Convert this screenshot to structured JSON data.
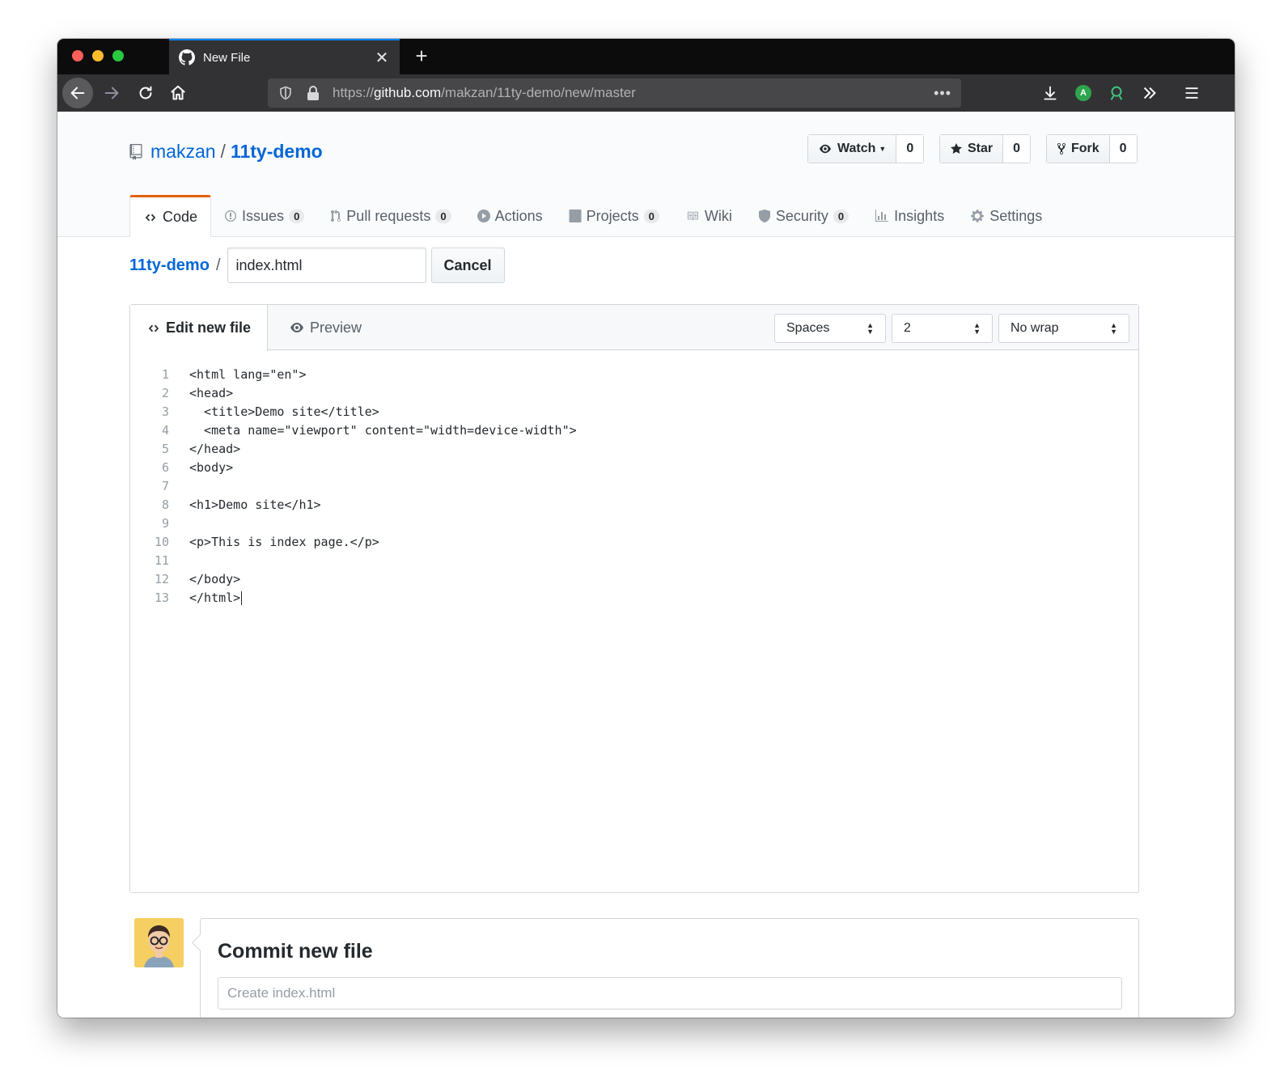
{
  "browser": {
    "tab_title": "New File",
    "url_scheme": "https://",
    "url_host": "github.com",
    "url_path": "/makzan/11ty-demo/new/master",
    "profile_badge": "A",
    "more": "•••"
  },
  "repo": {
    "owner": "makzan",
    "separator": "/",
    "name": "11ty-demo",
    "watch_label": "Watch",
    "watch_count": "0",
    "star_label": "Star",
    "star_count": "0",
    "fork_label": "Fork",
    "fork_count": "0"
  },
  "nav": {
    "code": "Code",
    "issues": "Issues",
    "issues_count": "0",
    "pulls": "Pull requests",
    "pulls_count": "0",
    "actions": "Actions",
    "projects": "Projects",
    "projects_count": "0",
    "wiki": "Wiki",
    "security": "Security",
    "security_count": "0",
    "insights": "Insights",
    "settings": "Settings"
  },
  "breadcrumb": {
    "root": "11ty-demo",
    "slash": "/",
    "filename": "index.html",
    "cancel": "Cancel"
  },
  "editor": {
    "tab_edit": "Edit new file",
    "tab_preview": "Preview",
    "indent_mode": "Spaces",
    "indent_size": "2",
    "wrap_mode": "No wrap",
    "lines": [
      "<html lang=\"en\">",
      "<head>",
      "  <title>Demo site</title>",
      "  <meta name=\"viewport\" content=\"width=device-width\">",
      "</head>",
      "<body>",
      "",
      "<h1>Demo site</h1>",
      "",
      "<p>This is index page.</p>",
      "",
      "</body>",
      "</html>"
    ]
  },
  "commit": {
    "title": "Commit new file",
    "placeholder": "Create index.html"
  }
}
